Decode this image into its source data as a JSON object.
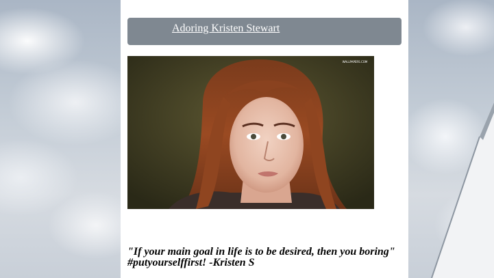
{
  "header": {
    "title_link": "Adoring Kristen Stewart"
  },
  "photo": {
    "watermark": "WALLPAPERS.COM"
  },
  "quote": {
    "line1": "\"If your main goal in life is to be desired, then you boring\"",
    "line2": "#putyourselffirst! -Kristen S"
  },
  "colors": {
    "title_bar": "#7f8891",
    "column_bg": "#ffffff",
    "link": "#ffffff"
  }
}
